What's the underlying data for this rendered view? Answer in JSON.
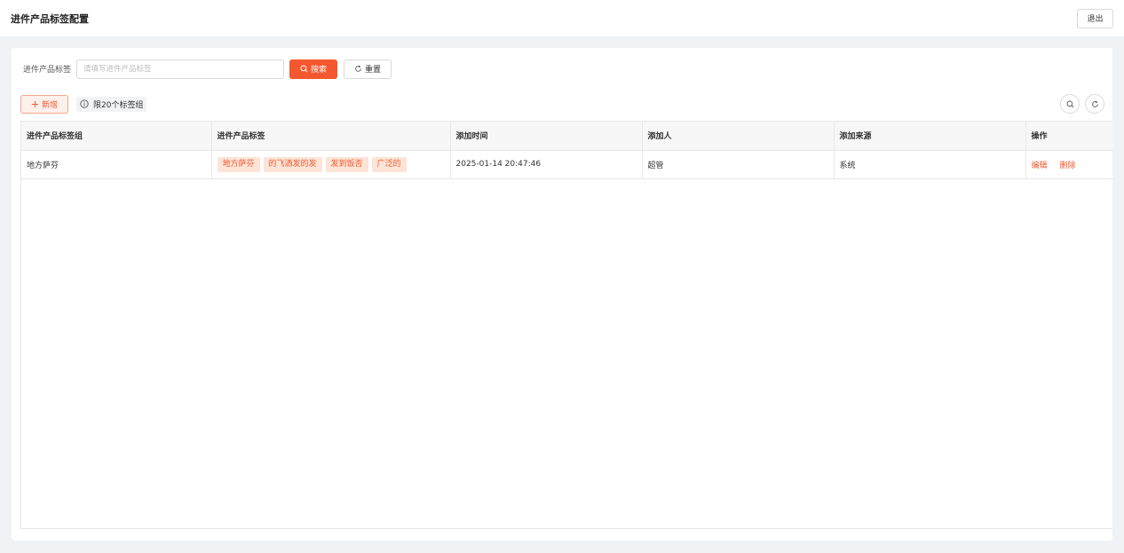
{
  "header": {
    "title": "进件产品标签配置",
    "logout_label": "退出"
  },
  "search": {
    "label": "进件产品标签",
    "placeholder": "请填写进件产品标签",
    "value": "",
    "search_label": "搜索",
    "reset_label": "重置"
  },
  "toolbar": {
    "add_label": "新增",
    "limit_text": "限20个标签组"
  },
  "table": {
    "headers": [
      "进件产品标签组",
      "进件产品标签",
      "添加时间",
      "添加人",
      "添加来源",
      "操作"
    ],
    "rows": [
      {
        "group": "地方萨芬",
        "tags": [
          "地方萨芬",
          "的飞洒发的发",
          "发到饭否",
          "广泛的"
        ],
        "time": "2025-01-14 20:47:46",
        "creator": "超管",
        "source": "系统",
        "edit_label": "编辑",
        "delete_label": "删除"
      }
    ]
  },
  "colors": {
    "accent": "#f5582e",
    "tag_bg": "#fde4d6",
    "page_bg": "#f0f2f5"
  },
  "icons": {
    "search": "search-icon",
    "reset": "refresh-icon",
    "add": "plus-icon",
    "info": "info-icon",
    "table_search": "search-icon",
    "table_refresh": "refresh-icon"
  }
}
